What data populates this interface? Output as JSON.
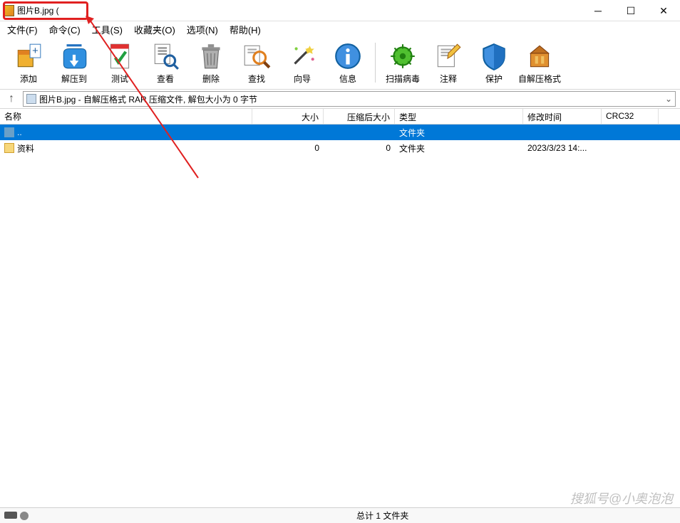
{
  "titlebar": {
    "title": "图片B.jpg ("
  },
  "menu": [
    "文件(F)",
    "命令(C)",
    "工具(S)",
    "收藏夹(O)",
    "选项(N)",
    "帮助(H)"
  ],
  "toolbar": [
    {
      "id": "add",
      "label": "添加"
    },
    {
      "id": "extract",
      "label": "解压到"
    },
    {
      "id": "test",
      "label": "测试"
    },
    {
      "id": "view",
      "label": "查看"
    },
    {
      "id": "delete",
      "label": "删除"
    },
    {
      "id": "find",
      "label": "查找"
    },
    {
      "id": "wizard",
      "label": "向导"
    },
    {
      "id": "info",
      "label": "信息"
    },
    {
      "sep": true
    },
    {
      "id": "virus",
      "label": "扫描病毒"
    },
    {
      "id": "comment",
      "label": "注释"
    },
    {
      "id": "protect",
      "label": "保护"
    },
    {
      "id": "sfx",
      "label": "自解压格式"
    }
  ],
  "pathbar": {
    "text": "图片B.jpg - 自解压格式 RAR 压缩文件, 解包大小为 0 字节"
  },
  "columns": {
    "name": "名称",
    "size": "大小",
    "packed": "压缩后大小",
    "type": "类型",
    "modified": "修改时间",
    "crc": "CRC32"
  },
  "rows": [
    {
      "name": "..",
      "size": "",
      "packed": "",
      "type": "文件夹",
      "modified": "",
      "crc": "",
      "selected": true,
      "icon": "updir"
    },
    {
      "name": "资料",
      "size": "0",
      "packed": "0",
      "type": "文件夹",
      "modified": "2023/3/23 14:...",
      "crc": "",
      "selected": false,
      "icon": "folder"
    }
  ],
  "status": {
    "center": "总计 1 文件夹"
  },
  "watermark": "搜狐号@小奥泡泡",
  "icons": {
    "add": "<svg viewBox='0 0 40 40'><rect x='6' y='12' width='20' height='22' fill='#f0b030' stroke='#806010'/><rect x='6' y='12' width='20' height='6' fill='#e08020'/><rect x='22' y='4' width='14' height='18' fill='#fff' stroke='#4080c0'/><text x='29' y='17' font-size='14' fill='#2060a0' text-anchor='middle'>+</text></svg>",
    "extract": "<svg viewBox='0 0 40 40'><path d='M6 16 Q6 10 14 10 L30 10 Q36 10 36 16 L36 30 Q36 36 30 36 L12 36 Q6 36 6 30 Z' fill='#3090e0' stroke='#1060a0'/><rect x='10' y='4' width='20' height='3' fill='#2070c0'/><rect x='18' y='18' width='4' height='10' fill='#fff'/><path d='M14 26 L20 34 L26 26 Z' fill='#fff'/></svg>",
    "test": "<svg viewBox='0 0 40 40'><rect x='8' y='4' width='24' height='32' fill='#fff' stroke='#888'/><rect x='8' y='4' width='24' height='6' fill='#e03030'/><path d='M14 22 L18 28 L28 14' stroke='#20a040' stroke-width='4' fill='none'/></svg>",
    "view": "<svg viewBox='0 0 40 40'><rect x='6' y='4' width='20' height='26' fill='#fff' stroke='#888'/><rect x='10' y='8' width='12' height='2' fill='#888'/><rect x='10' y='12' width='12' height='2' fill='#888'/><rect x='10' y='16' width='12' height='2' fill='#888'/><circle cx='26' cy='26' r='7' fill='none' stroke='#2060a0' stroke-width='3'/><line x1='31' y1='31' x2='37' y2='37' stroke='#2060a0' stroke-width='3'/></svg>",
    "delete": "<svg viewBox='0 0 40 40'><path d='M10 12 L30 12 L28 36 L12 36 Z' fill='#b0b0b0' stroke='#666'/><rect x='8' y='8' width='24' height='4' fill='#909090'/><rect x='16' y='4' width='8' height='4' fill='#909090'/><line x1='15' y1='16' x2='16' y2='32' stroke='#666'/><line x1='20' y1='16' x2='20' y2='32' stroke='#666'/><line x1='25' y1='16' x2='24' y2='32' stroke='#666'/></svg>",
    "find": "<svg viewBox='0 0 40 40'><rect x='4' y='6' width='20' height='26' fill='#fff' stroke='#888'/><rect x='8' y='10' width='12' height='2' fill='#aaa'/><rect x='8' y='14' width='12' height='2' fill='#aaa'/><circle cx='24' cy='22' r='8' fill='none' stroke='#e08020' stroke-width='3'/><line x1='30' y1='28' x2='37' y2='35' stroke='#804010' stroke-width='4'/></svg>",
    "wizard": "<svg viewBox='0 0 40 40'><line x1='10' y1='30' x2='26' y2='14' stroke='#404040' stroke-width='3'/><circle cx='28' cy='12' r='3' fill='#f0d040'/><path d='M30 6 L32 10 L36 10 L33 13 L34 17 L30 15 L26 17 L27 13 L24 10 L28 10 Z' fill='#f0d040'/><circle cx='12' cy='10' r='2' fill='#80d040'/><circle cx='34' cy='24' r='2' fill='#e06090'/></svg>",
    "info": "<svg viewBox='0 0 40 40'><circle cx='20' cy='20' r='16' fill='#4090e0' stroke='#1060a0' stroke-width='2'/><circle cx='20' cy='12' r='2.5' fill='#fff'/><rect x='17.5' y='17' width='5' height='14' fill='#fff'/></svg>",
    "virus": "<svg viewBox='0 0 40 40'><circle cx='20' cy='20' r='12' fill='#50c030' stroke='#208010' stroke-width='2'/><circle cx='20' cy='20' r='4' fill='#208010'/><line x1='20' y1='4' x2='20' y2='10' stroke='#208010' stroke-width='2'/><line x1='20' y1='30' x2='20' y2='36' stroke='#208010' stroke-width='2'/><line x1='4' y1='20' x2='10' y2='20' stroke='#208010' stroke-width='2'/><line x1='30' y1='20' x2='36' y2='20' stroke='#208010' stroke-width='2'/><line x1='9' y1='9' x2='13' y2='13' stroke='#208010' stroke-width='2'/><line x1='27' y1='27' x2='31' y2='31' stroke='#208010' stroke-width='2'/><line x1='31' y1='9' x2='27' y2='13' stroke='#208010' stroke-width='2'/><line x1='13' y1='27' x2='9' y2='31' stroke='#208010' stroke-width='2'/></svg>",
    "comment": "<svg viewBox='0 0 40 40'><rect x='6' y='6' width='22' height='28' fill='#fff' stroke='#888'/><rect x='10' y='10' width='14' height='2' fill='#aaa'/><rect x='10' y='14' width='14' height='2' fill='#aaa'/><rect x='10' y='18' width='10' height='2' fill='#aaa'/><path d='M24 20 L36 8 L32 4 L20 16 L19 23 Z' fill='#f0c040' stroke='#a06010'/></svg>",
    "protect": "<svg viewBox='0 0 40 40'><path d='M20 4 L34 10 L34 20 Q34 32 20 38 Q6 32 6 20 L6 10 Z' fill='#4090e0' stroke='#1060a0' stroke-width='2'/><path d='M20 4 L34 10 L34 20 Q34 32 20 38 Z' fill='#2070c0'/></svg>",
    "sfx": "<svg viewBox='0 0 40 40'><rect x='8' y='16' width='24' height='18' fill='#e09030' stroke='#804010'/><path d='M8 16 L20 6 L32 16 Z' fill='#c07020' stroke='#804010'/><rect x='14' y='20' width='4' height='10' fill='#f0c060'/><rect x='22' y='20' width='4' height='10' fill='#f0c060'/></svg>"
  }
}
